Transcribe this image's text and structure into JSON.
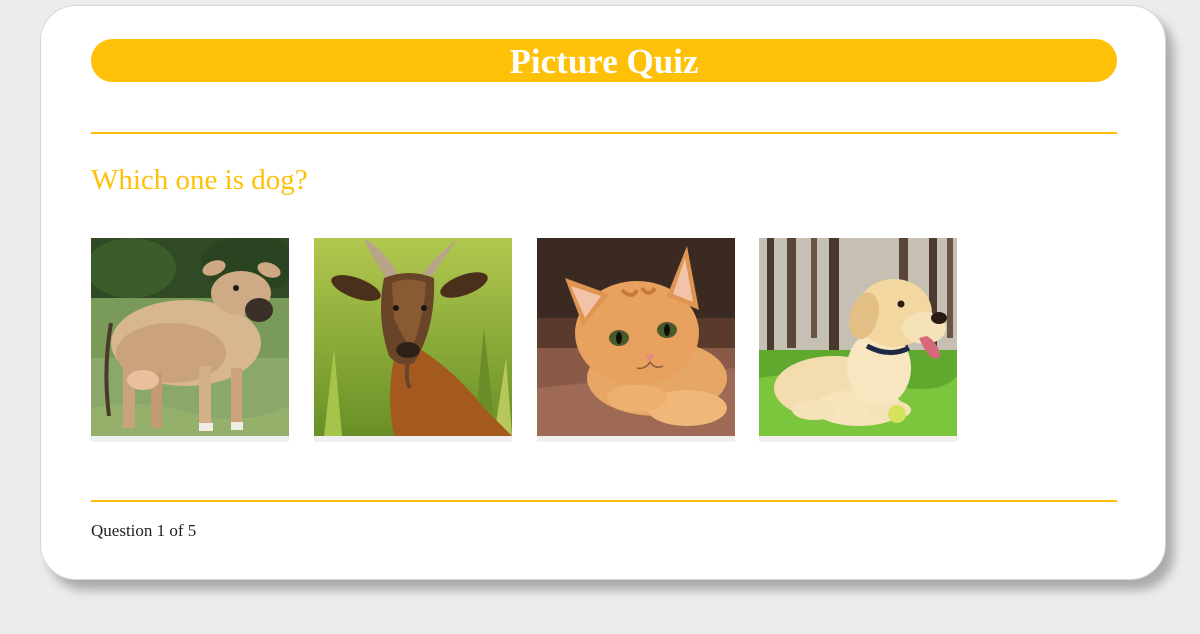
{
  "quiz": {
    "title": "Picture Quiz",
    "question": "Which one is dog?",
    "progress": "Question 1 of 5",
    "options": [
      {
        "animal": "cow",
        "icon": "cow-photo"
      },
      {
        "animal": "goat",
        "icon": "goat-photo"
      },
      {
        "animal": "cat",
        "icon": "kitten-photo"
      },
      {
        "animal": "dog",
        "icon": "dog-photo"
      }
    ]
  },
  "colors": {
    "accent": "#fec107",
    "background": "#ececec",
    "card": "#ffffff"
  }
}
